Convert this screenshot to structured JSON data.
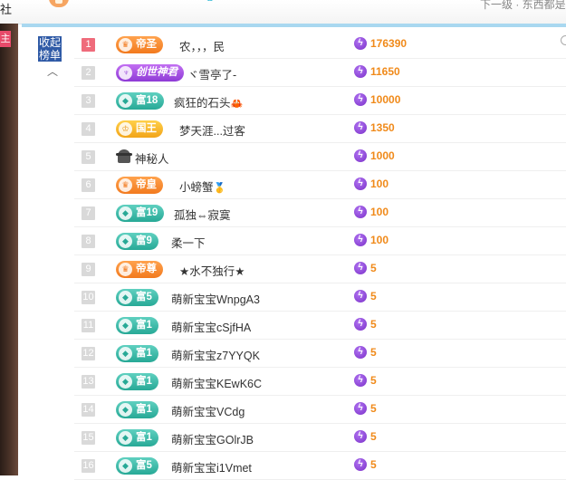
{
  "top": {
    "left_text": "社",
    "right_text": "下一级 · 东西都是"
  },
  "sidebar": {
    "anchor_tag": "主"
  },
  "panel": {
    "collapse_label_1": "收起",
    "collapse_label_2": "榜单",
    "collapse_arrow": "︿"
  },
  "rows": [
    {
      "rank": "1",
      "badge_label": "帝圣",
      "badge_style": "orange",
      "badge_icon": "crown-icon",
      "name": "农，，，民",
      "amount": "176390"
    },
    {
      "rank": "2",
      "badge_label": "创世神君",
      "badge_style": "purple",
      "badge_icon": "god-icon",
      "name": "ヾ雪亭了-",
      "amount": "11650"
    },
    {
      "rank": "3",
      "badge_label": "富18",
      "badge_style": "fu",
      "badge_icon": "gem-icon",
      "name": "疯狂的石头",
      "name_emoji": "🦀",
      "amount": "10000"
    },
    {
      "rank": "4",
      "badge_label": "国王",
      "badge_style": "gold",
      "badge_icon": "king-icon",
      "name": "梦天涯...过客",
      "amount": "1350"
    },
    {
      "rank": "5",
      "badge_label": "",
      "badge_style": "mystery",
      "badge_icon": "mystery-person-icon",
      "name": "神秘人",
      "amount": "1000"
    },
    {
      "rank": "6",
      "badge_label": "帝皇",
      "badge_style": "orange",
      "badge_icon": "crown-icon",
      "name": "小螃蟹",
      "name_emoji": "🥇",
      "amount": "100"
    },
    {
      "rank": "7",
      "badge_label": "富19",
      "badge_style": "fu",
      "badge_icon": "gem-icon",
      "name": "孤独⇔寂寞",
      "amount": "100"
    },
    {
      "rank": "8",
      "badge_label": "富9",
      "badge_style": "fu",
      "badge_icon": "gem-icon",
      "name": "柔一下",
      "amount": "100"
    },
    {
      "rank": "9",
      "badge_label": "帝尊",
      "badge_style": "orange",
      "badge_icon": "crown-icon",
      "name": "★水不独行★",
      "amount": "5"
    },
    {
      "rank": "10",
      "badge_label": "富5",
      "badge_style": "fu",
      "badge_icon": "gem-icon",
      "name": "萌新宝宝WnpgA3",
      "amount": "5"
    },
    {
      "rank": "11",
      "badge_label": "富1",
      "badge_style": "fu",
      "badge_icon": "gem-icon",
      "name": "萌新宝宝cSjfHA",
      "amount": "5"
    },
    {
      "rank": "12",
      "badge_label": "富1",
      "badge_style": "fu",
      "badge_icon": "gem-icon",
      "name": "萌新宝宝z7YYQK",
      "amount": "5"
    },
    {
      "rank": "13",
      "badge_label": "富1",
      "badge_style": "fu",
      "badge_icon": "gem-icon",
      "name": "萌新宝宝KEwK6C",
      "amount": "5"
    },
    {
      "rank": "14",
      "badge_label": "富1",
      "badge_style": "fu",
      "badge_icon": "gem-icon",
      "name": "萌新宝宝VCdg",
      "amount": "5"
    },
    {
      "rank": "15",
      "badge_label": "富1",
      "badge_style": "fu",
      "badge_icon": "gem-icon",
      "name": "萌新宝宝GOlrJB",
      "amount": "5"
    },
    {
      "rank": "16",
      "badge_label": "富5",
      "badge_style": "fu",
      "badge_icon": "gem-icon",
      "name": "萌新宝宝i1Vmet",
      "amount": "5"
    }
  ],
  "colors": {
    "rank_first": "#ef6b7b",
    "rank_default": "#d9d9d9",
    "amount": "#f08a1a",
    "panel_border": "#a9d8f0",
    "fu_badge": "#27a996",
    "orange_badge": "#f27a1e",
    "gold_badge": "#f2a418",
    "purple_badge": "#8e3bd6"
  }
}
